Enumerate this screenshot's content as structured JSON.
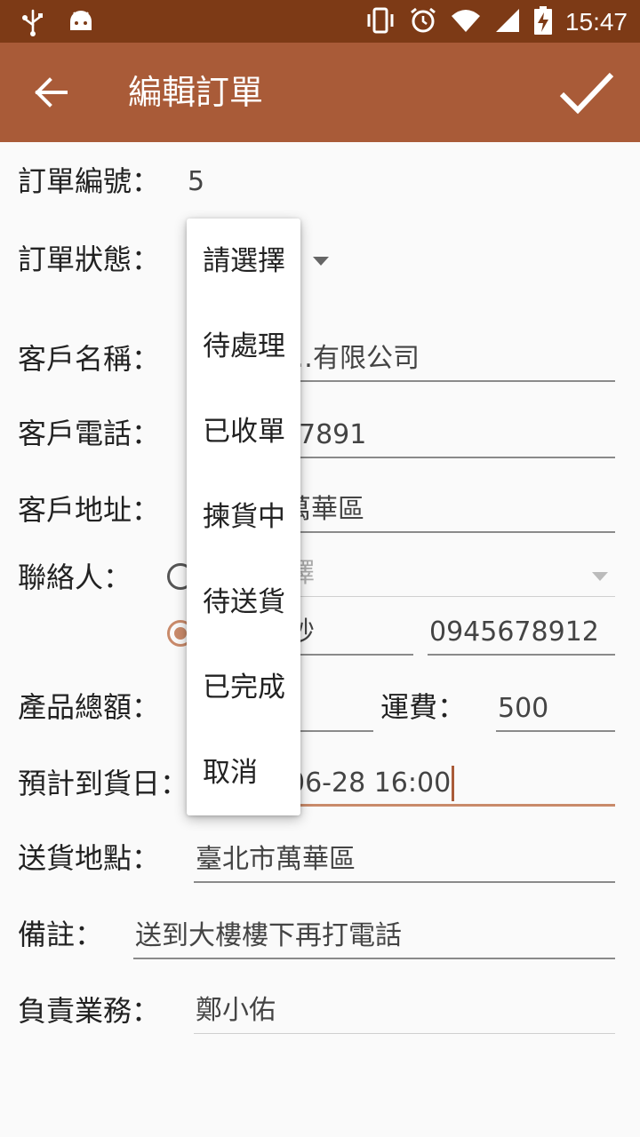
{
  "status_bar": {
    "time": "15:47",
    "icons": [
      "usb-icon",
      "android-icon",
      "vibrate-icon",
      "alarm-icon",
      "wifi-icon",
      "signal-icon",
      "battery-charging-icon"
    ]
  },
  "app_bar": {
    "title": "編輯訂單",
    "back_icon": "arrow-back-icon",
    "confirm_icon": "check-icon",
    "color": "#a95b38"
  },
  "form": {
    "order_number": {
      "label": "訂單編號：",
      "value": "5"
    },
    "order_status": {
      "label": "訂單狀態："
    },
    "customer_name": {
      "label": "客戶名稱：",
      "value": "…有限公司"
    },
    "customer_phone": {
      "label": "客戶電話：",
      "value": "7891"
    },
    "customer_address": {
      "label": "客戶地址：",
      "value": "萬華區"
    },
    "contact": {
      "label": "聯絡人：",
      "select_placeholder": "擇",
      "contact_name": "秒",
      "contact_phone": "0945678912"
    },
    "product_total": {
      "label": "產品總額："
    },
    "shipping_fee": {
      "label": "運費：",
      "value": "500"
    },
    "estimated_delivery": {
      "label": "預計到貨日：",
      "value": "06-28 16:00"
    },
    "delivery_location": {
      "label": "送貨地點：",
      "value": "臺北市萬華區"
    },
    "notes": {
      "label": "備註：",
      "value": "送到大樓樓下再打電話"
    },
    "salesperson": {
      "label": "負責業務：",
      "value": "鄭小佑"
    }
  },
  "status_dropdown": {
    "options": [
      "請選擇",
      "待處理",
      "已收單",
      "揀貨中",
      "待送貨",
      "已完成",
      "取消"
    ]
  }
}
